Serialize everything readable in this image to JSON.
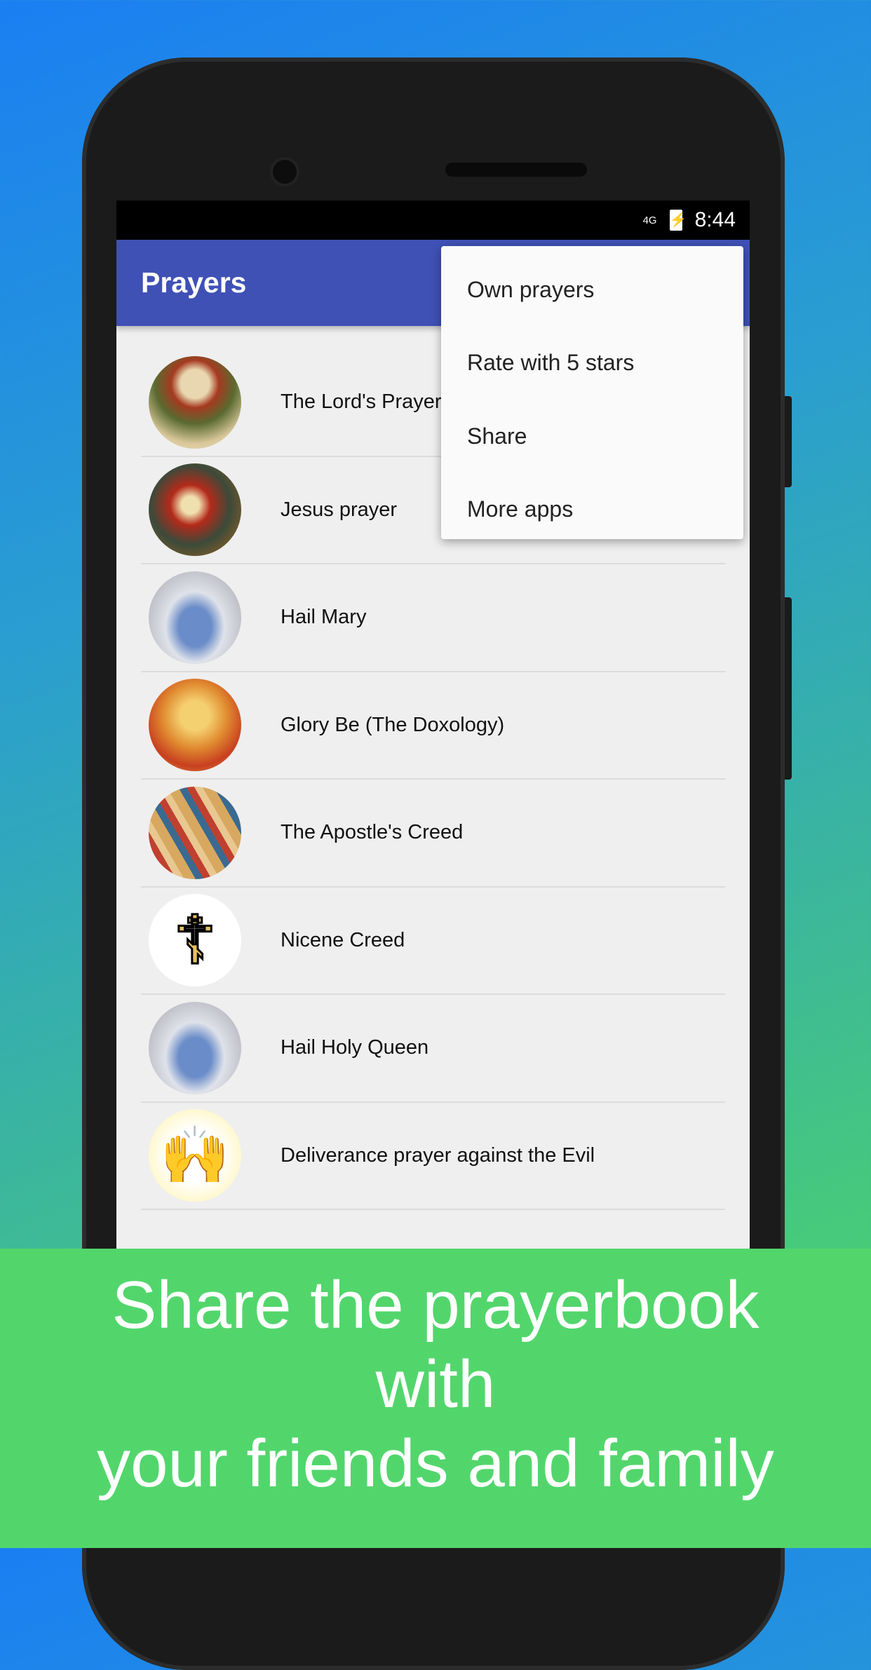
{
  "status_bar": {
    "network": "4G",
    "time": "8:44",
    "battery_icon": "battery-charging-icon"
  },
  "app_bar": {
    "title": "Prayers",
    "color": "#3f51b5"
  },
  "overflow_menu": {
    "items": [
      {
        "label": "Own prayers"
      },
      {
        "label": "Rate with 5 stars"
      },
      {
        "label": "Share"
      },
      {
        "label": "More apps"
      }
    ]
  },
  "prayers": [
    {
      "label": "The Lord's Prayer",
      "image": "god-the-father-icon"
    },
    {
      "label": "Jesus prayer",
      "image": "jesus-praying-icon"
    },
    {
      "label": "Hail Mary",
      "image": "virgin-mary-icon"
    },
    {
      "label": "Glory Be (The Doxology)",
      "image": "holy-trinity-icon"
    },
    {
      "label": "The Apostle's Creed",
      "image": "apostles-icon"
    },
    {
      "label": "Nicene Creed",
      "image": "orthodox-cross-icon"
    },
    {
      "label": "Hail Holy Queen",
      "image": "virgin-mary-icon"
    },
    {
      "label": "Deliverance prayer against the Evil",
      "image": "broken-chains-icon"
    }
  ],
  "banner": {
    "lines": [
      "Share the prayerbook",
      "with",
      "your friends and family"
    ],
    "color": "#52d66c"
  }
}
